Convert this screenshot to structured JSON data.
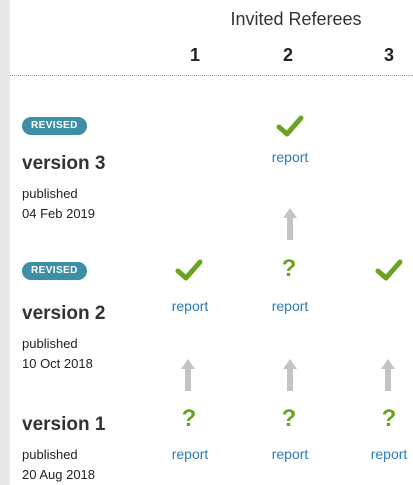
{
  "header": {
    "title": "Invited Referees",
    "columns": [
      "1",
      "2",
      "3"
    ]
  },
  "versions": [
    {
      "badge": "REVISED",
      "title": "version 3",
      "published_label": "published",
      "date": "04 Feb 2019"
    },
    {
      "badge": "REVISED",
      "title": "version 2",
      "published_label": "published",
      "date": "10 Oct 2018"
    },
    {
      "badge": "",
      "title": "version 1",
      "published_label": "published",
      "date": "20 Aug 2018"
    }
  ],
  "reports": {
    "v3_r2": {
      "status": "approved",
      "label": "report"
    },
    "v2_r1": {
      "status": "approved",
      "label": "report"
    },
    "v2_r2": {
      "status": "reservations",
      "label": "report",
      "icon_text": "?"
    },
    "v2_r3": {
      "status": "approved",
      "label": ""
    },
    "v1_r1": {
      "status": "reservations",
      "label": "report",
      "icon_text": "?"
    },
    "v1_r2": {
      "status": "reservations",
      "label": "report",
      "icon_text": "?"
    },
    "v1_r3": {
      "status": "reservations",
      "label": "report",
      "icon_text": "?"
    }
  },
  "colors": {
    "badge": "#3d8fa5",
    "check": "#6aa31f",
    "link": "#2b7bb9",
    "arrow": "#c4c4c4"
  },
  "icons": {
    "approved": "checkmark-icon",
    "reservations": "question-mark-icon",
    "history": "up-arrow-icon"
  }
}
